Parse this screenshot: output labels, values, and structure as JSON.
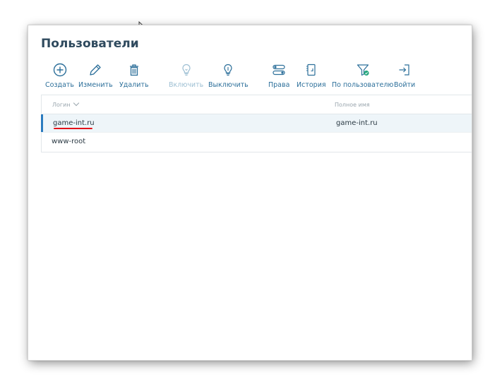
{
  "page": {
    "title": "Пользователи"
  },
  "toolbar": {
    "create": "Создать",
    "edit": "Изменить",
    "delete": "Удалить",
    "enable": "Включить",
    "disable": "Выключить",
    "rights": "Права",
    "history": "История",
    "by_user": "По пользователю",
    "login_as": "Войти"
  },
  "table": {
    "columns": {
      "login": "Логин",
      "full_name": "Полное имя"
    },
    "rows": [
      {
        "login": "game-int.ru",
        "full_name": "game-int.ru",
        "selected": true
      },
      {
        "login": "www-root",
        "full_name": ""
      }
    ]
  },
  "colors": {
    "title": "#2f4a5e",
    "accent": "#2a7bbf",
    "link": "#2c6f9a",
    "disabled": "#9dbfd3",
    "highlight_underline": "#e3131a",
    "filter_badge": "#27a77e"
  }
}
